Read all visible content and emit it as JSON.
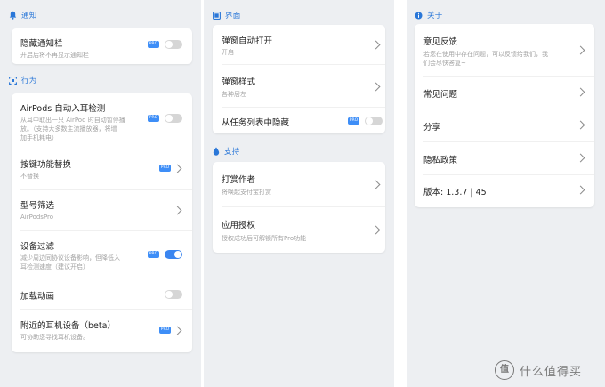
{
  "panel1": {
    "sections": {
      "notify": "通知",
      "behavior": "行为"
    },
    "hide_notif": {
      "title": "隐藏通知栏",
      "sub": "开启后将不再显示通知栏",
      "pro": "PRO"
    },
    "airpods_detect": {
      "title": "AirPods 自动入耳检测",
      "sub1": "从耳中取出一只 AirPod 时自动暂停播",
      "sub2": "放。（支持大多数主流播放器，将增",
      "sub3": "加手机耗电）",
      "pro": "PRO"
    },
    "button_replace": {
      "title": "按键功能替换",
      "sub": "不替换",
      "pro": "PRO"
    },
    "model_filter": {
      "title": "型号筛选",
      "sub": "AirPodsPro"
    },
    "device_filter": {
      "title": "设备过滤",
      "sub1": "减少周边同协议设备影响，但降低入",
      "sub2": "耳检测速度（建议开启）",
      "pro": "PRO"
    },
    "load_anim": {
      "title": "加载动画"
    },
    "nearby": {
      "title": "附近的耳机设备（beta）",
      "sub": "可协助您寻找耳机设备。",
      "pro": "PRO"
    }
  },
  "panel2": {
    "sections": {
      "ui": "界面",
      "support": "支持"
    },
    "popup_auto": {
      "title": "弹窗自动打开",
      "sub": "开启"
    },
    "popup_style": {
      "title": "弹窗样式",
      "sub": "各种居左"
    },
    "hide_recent": {
      "title": "从任务列表中隐藏",
      "pro": "PRO"
    },
    "donate": {
      "title": "打赏作者",
      "sub": "将唤起支付宝打赏"
    },
    "license": {
      "title": "应用授权",
      "sub": "授权成功后可解锁所有Pro功能"
    }
  },
  "panel3": {
    "sections": {
      "about": "关于"
    },
    "feedback": {
      "title": "意见反馈",
      "sub1": "若您在使用中存在问题，可以反馈给我们，我",
      "sub2": "们会尽快答复~"
    },
    "faq": {
      "title": "常见问题"
    },
    "share": {
      "title": "分享"
    },
    "privacy": {
      "title": "隐私政策"
    },
    "version": {
      "title": "版本: 1.3.7 | 45"
    }
  },
  "toggles": {
    "hide_notif": false,
    "airpods_detect": false,
    "device_filter": true,
    "load_anim": false,
    "hide_recent": false
  },
  "watermark": {
    "icon": "值",
    "text": "什么值得买"
  },
  "colors": {
    "accent": "#2a77d8",
    "pro_badge": "#3e8ef7",
    "toggle_on": "#3b86f0"
  }
}
